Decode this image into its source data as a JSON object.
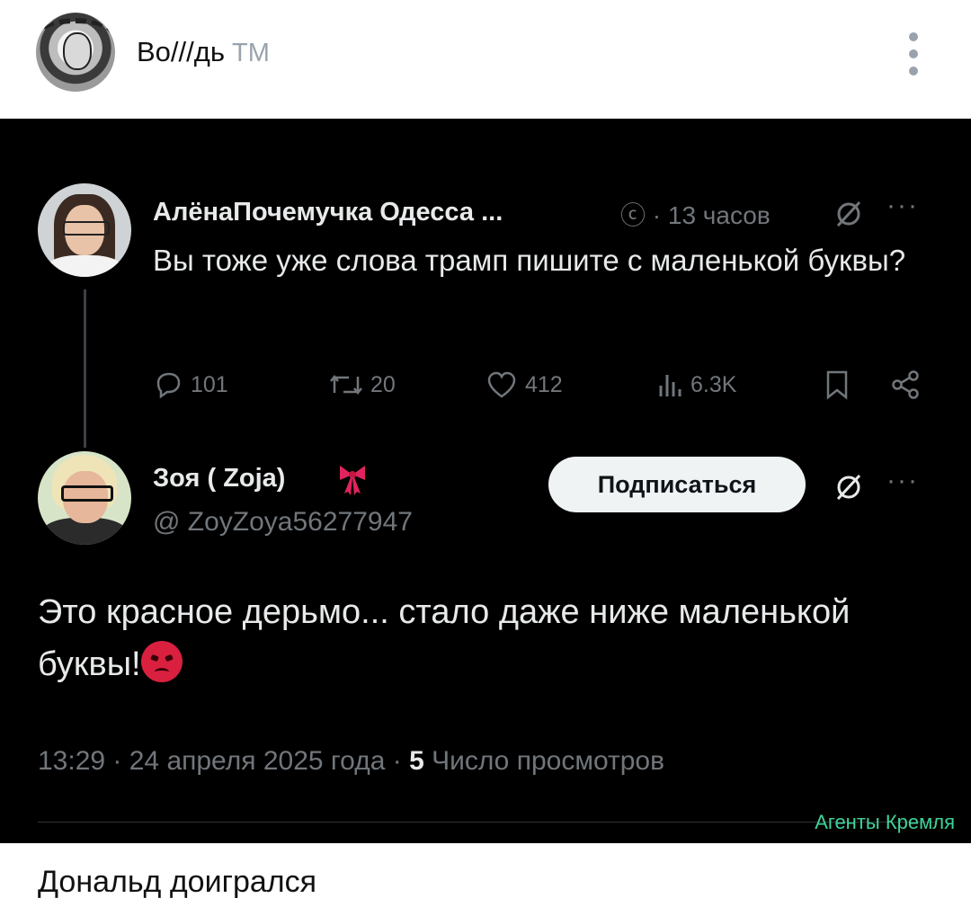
{
  "channel": {
    "name": "Bo///дь",
    "badge": "TM"
  },
  "tweet1": {
    "name": "АлёнаПочемучка Одесса ...",
    "meta": "ⓒ · 13 часов",
    "text": "Вы тоже уже слова трамп  пишите с маленькой буквы?",
    "replies": "101",
    "retweets": "20",
    "likes": "412",
    "views": "6.3K",
    "more": "···"
  },
  "tweet2": {
    "name": "Зоя ( Zoja)",
    "handle": "@ ZoyZoya56277947",
    "follow_label": "Подписаться",
    "text": "Это красное дерьмо... стало даже ниже маленькой буквы!",
    "time": "13:29 · 24 апреля 2025 года · ",
    "views_count": "5",
    "views_label": " Число просмотров",
    "more": "···"
  },
  "watermark": "Агенты Кремля",
  "caption": "Дональд доигрался",
  "icons": {
    "grok": "grok-icon",
    "reply": "reply-icon",
    "retweet": "retweet-icon",
    "like": "heart-icon",
    "views": "views-icon",
    "bookmark": "bookmark-icon",
    "share": "share-icon",
    "bow": "ribbon-emoji",
    "angry": "angry-face-emoji"
  },
  "colors": {
    "tweet_bg": "#000000",
    "muted": "#71767b",
    "text": "#e7e9ea",
    "watermark": "#3fd39a"
  }
}
